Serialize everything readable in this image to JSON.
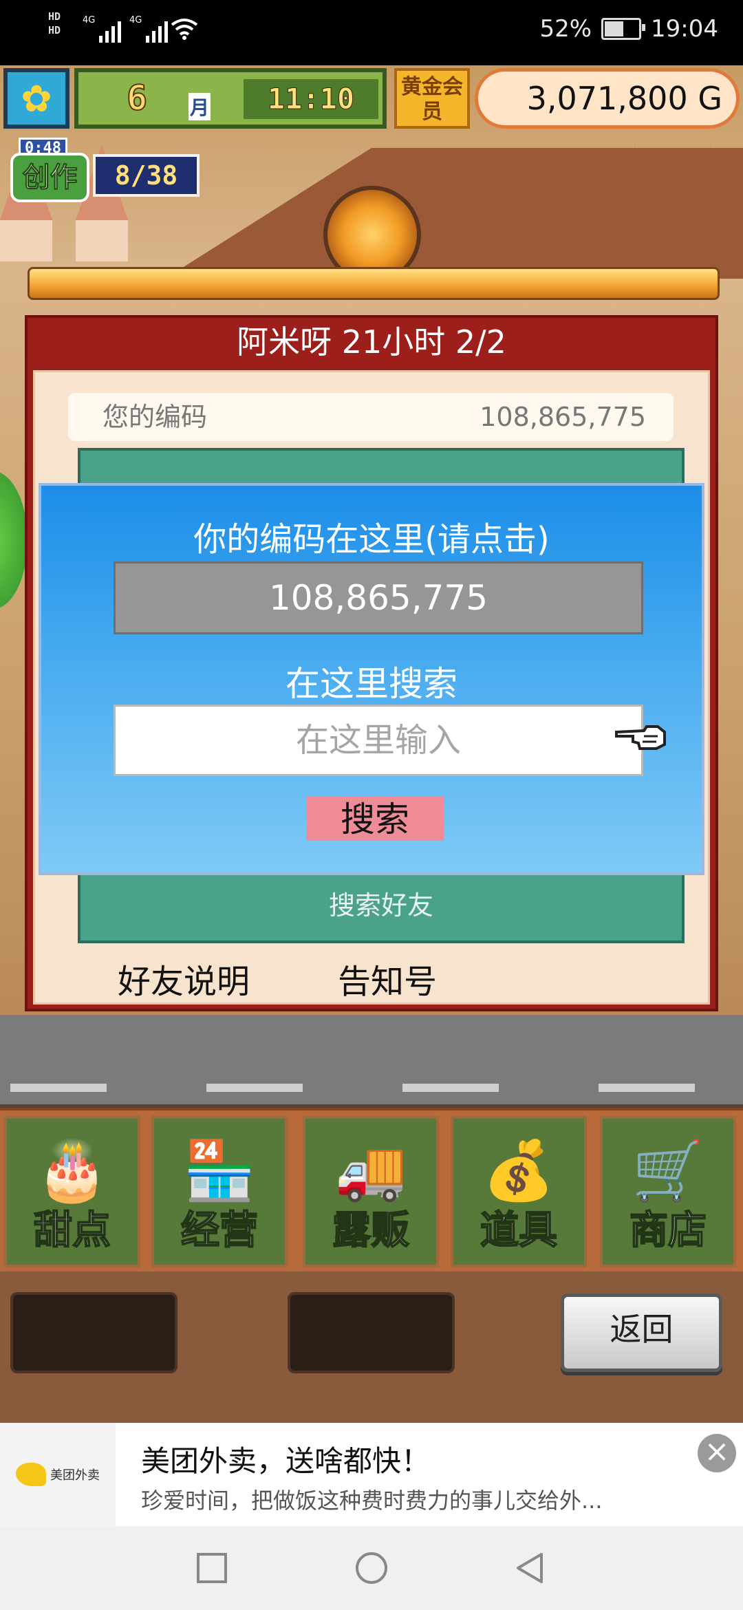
{
  "status_bar": {
    "hd_top": "HD",
    "hd_bottom": "HD",
    "net1": "4G",
    "net2": "4G",
    "battery": "52%",
    "time": "19:04"
  },
  "hud": {
    "month": "6",
    "month_label": "月",
    "time": "11:10",
    "gold_member": "黄金会员",
    "money": "3,071,800 G"
  },
  "create_badge": {
    "timer": "0:48",
    "label": "创作",
    "count": "8/38"
  },
  "friend_panel": {
    "title": "阿米呀  21小时 2/2",
    "code_label": "您的编码",
    "code_value": "108,865,775",
    "search_friend_ghost": "搜索好友",
    "link_explain": "好友说明",
    "link_notice": "告知号"
  },
  "dialog": {
    "title": "你的编码在这里(请点击)",
    "code_value": "108,865,775",
    "search_label": "在这里搜索",
    "input_placeholder": "在这里输入",
    "search_button": "搜索"
  },
  "menu": {
    "items": [
      {
        "label": "甜点",
        "icon": "cake-icon"
      },
      {
        "label": "经营",
        "icon": "shop-building-icon"
      },
      {
        "label": "露贩",
        "icon": "food-truck-icon"
      },
      {
        "label": "道具",
        "icon": "items-bag-icon"
      },
      {
        "label": "商店",
        "icon": "shopping-cart-icon"
      }
    ]
  },
  "back_button": "返回",
  "ad": {
    "logo_text": "美团外卖",
    "title": "美团外卖，送啥都快！",
    "desc": "珍爱时间，把做饭这种费时费力的事儿交给外..."
  },
  "colors": {
    "panel_red": "#9c1f1c",
    "dialog_blue": "#1c8de8",
    "search_button": "#f08c98",
    "menu_green": "#577a3a"
  }
}
